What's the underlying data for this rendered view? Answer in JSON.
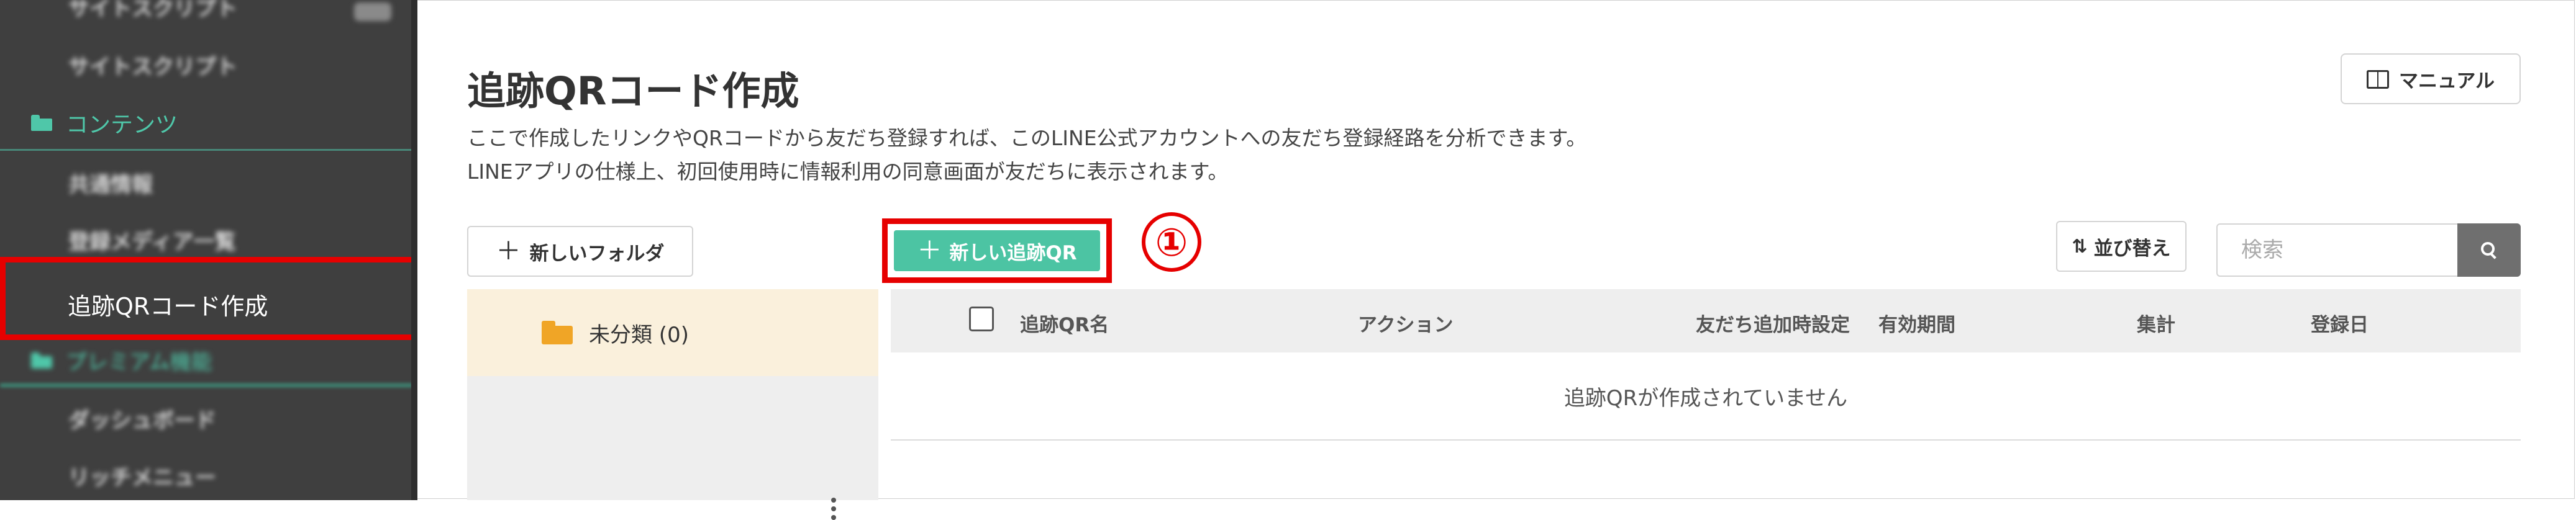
{
  "sidebar": {
    "blurred_top": [
      "サイトスクリプト"
    ],
    "section_header": "コンテンツ",
    "blurred_items": [
      "共通情報",
      "登録メディア一覧"
    ],
    "active_item": "追跡QRコード作成",
    "blurred_section": "プレミアム機能",
    "blurred_bottom": [
      "ダッシュボード",
      "リッチメニュー"
    ]
  },
  "header": {
    "title": "追跡QRコード作成",
    "description_line1": "ここで作成したリンクやQRコードから友だち登録すれば、このLINE公式アカウントへの友だち登録経路を分析できます。",
    "description_line2": "LINEアプリの仕様上、初回使用時に情報利用の同意画面が友だちに表示されます。",
    "manual_label": "マニュアル"
  },
  "toolbar": {
    "new_folder_label": "新しいフォルダ",
    "new_qr_label": "新しい追跡QR",
    "step_marker": "①",
    "sort_label": "並び替え",
    "search_placeholder": "検索"
  },
  "folders": [
    {
      "label": "未分類 (0)"
    }
  ],
  "table": {
    "columns": [
      "追跡QR名",
      "アクション",
      "友だち追加時設定",
      "有効期間",
      "集計",
      "登録日"
    ],
    "empty_message": "追跡QRが作成されていません"
  },
  "colors": {
    "sidebar_bg": "#3f3f3f",
    "accent_green": "#4cc4a3",
    "highlight_red": "#e60000",
    "folder_orange": "#f0a526"
  }
}
